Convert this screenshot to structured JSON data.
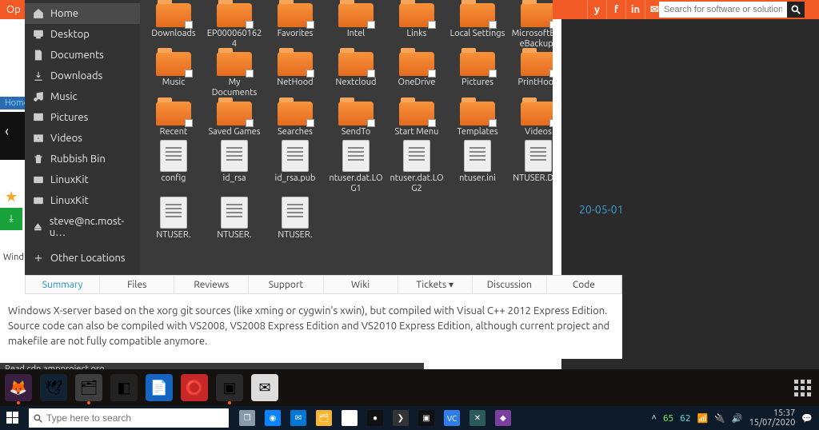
{
  "orange": {
    "op_text": "Op",
    "search_placeholder": "Search for software or solutions"
  },
  "social": [
    "y",
    "f",
    "in",
    "✉"
  ],
  "right_panel": {
    "release_date": "20-05-01"
  },
  "left_frag": {
    "home": "Home",
    "wind": "Wind"
  },
  "fm_sidebar": [
    {
      "icon": "home",
      "label": "Home",
      "sel": true
    },
    {
      "icon": "desktop",
      "label": "Desktop"
    },
    {
      "icon": "doc",
      "label": "Documents"
    },
    {
      "icon": "download",
      "label": "Downloads"
    },
    {
      "icon": "music",
      "label": "Music"
    },
    {
      "icon": "picture",
      "label": "Pictures"
    },
    {
      "icon": "video",
      "label": "Videos"
    },
    {
      "icon": "trash",
      "label": "Rubbish Bin"
    },
    {
      "icon": "disk",
      "label": "LinuxKit"
    },
    {
      "icon": "disk",
      "label": "LinuxKit"
    },
    {
      "icon": "eject",
      "label": "steve@nc.most-u…"
    },
    {
      "icon": "plus",
      "label": "Other Locations",
      "cls": "plus"
    }
  ],
  "fm_items": [
    {
      "t": "fs",
      "n": "Downloads"
    },
    {
      "t": "fs",
      "n": "EP0000601624"
    },
    {
      "t": "fs",
      "n": "Favorites"
    },
    {
      "t": "fs",
      "n": "Intel"
    },
    {
      "t": "fs",
      "n": "Links"
    },
    {
      "t": "fs",
      "n": "Local Settings"
    },
    {
      "t": "fs",
      "n": "MicrosoftEdgeBackups"
    },
    {
      "t": "fs",
      "n": "Music"
    },
    {
      "t": "fs",
      "n": "My Documents"
    },
    {
      "t": "fs",
      "n": "NetHood"
    },
    {
      "t": "fs",
      "n": "Nextcloud"
    },
    {
      "t": "fs",
      "n": "OneDrive"
    },
    {
      "t": "fs",
      "n": "Pictures"
    },
    {
      "t": "fs",
      "n": "PrintHood"
    },
    {
      "t": "fs",
      "n": "Recent"
    },
    {
      "t": "fs",
      "n": "Saved Games"
    },
    {
      "t": "fs",
      "n": "Searches"
    },
    {
      "t": "fs",
      "n": "SendTo"
    },
    {
      "t": "fs",
      "n": "Start Menu"
    },
    {
      "t": "fs",
      "n": "Templates"
    },
    {
      "t": "fs",
      "n": "Videos"
    },
    {
      "t": "d",
      "n": "config"
    },
    {
      "t": "d",
      "n": "id_rsa"
    },
    {
      "t": "d",
      "n": "id_rsa.pub"
    },
    {
      "t": "d",
      "n": "ntuser.dat.LOG1"
    },
    {
      "t": "d",
      "n": "ntuser.dat.LOG2"
    },
    {
      "t": "d",
      "n": "ntuser.ini"
    },
    {
      "t": "d",
      "n": "NTUSER.DAT"
    },
    {
      "t": "d",
      "n": "NTUSER."
    },
    {
      "t": "d",
      "n": "NTUSER."
    },
    {
      "t": "d",
      "n": "NTUSER."
    }
  ],
  "tabs": [
    {
      "label": "Summary",
      "active": true
    },
    {
      "label": "Files"
    },
    {
      "label": "Reviews"
    },
    {
      "label": "Support"
    },
    {
      "label": "Wiki"
    },
    {
      "label": "Tickets ▾"
    },
    {
      "label": "Discussion"
    },
    {
      "label": "Code"
    }
  ],
  "description": "Windows X-server based on the xorg git sources (like xming or cygwin's xwin), but compiled with Visual C++ 2012 Express Edition. Source code can also be compiled with VS2008, VS2008 Express Edition and VS2010 Express Edition, although current project and makefile are not fully compatible anymore.",
  "status_strip": "Read cdn.ampproject.org",
  "dock": [
    {
      "name": "firefox",
      "bg": "#3a2040",
      "glyph": "🦊",
      "pip": true
    },
    {
      "name": "thunderbird",
      "bg": "#123",
      "glyph": "🕊",
      "pip": false
    },
    {
      "name": "files",
      "bg": "#3e3e3e",
      "glyph": "🗂",
      "pip": true
    },
    {
      "name": "rect",
      "bg": "#222",
      "glyph": "◧",
      "pip": false
    },
    {
      "name": "writer",
      "bg": "#1565c0",
      "glyph": "📄",
      "pip": false
    },
    {
      "name": "help",
      "bg": "#c62828",
      "glyph": "⭕",
      "pip": false
    },
    {
      "name": "terminal",
      "bg": "#2a2a2a",
      "glyph": "▣",
      "pip": true
    },
    {
      "name": "mail",
      "bg": "#ddd",
      "glyph": "✉",
      "pip": false
    }
  ],
  "taskbar_search_placeholder": "Type here to search",
  "taskbar_apps": [
    {
      "name": "taskview",
      "c": "#8899aa",
      "g": "❐"
    },
    {
      "name": "edge",
      "c": "#0a84ff",
      "g": "◉"
    },
    {
      "name": "mail",
      "c": "#0078d4",
      "g": "✉"
    },
    {
      "name": "explorer",
      "c": "#f7b531",
      "g": "🗂"
    },
    {
      "name": "store",
      "c": "#ffffff",
      "g": "🛍"
    },
    {
      "name": "blackapp",
      "c": "#111",
      "g": "●"
    },
    {
      "name": "terminal",
      "c": "#333",
      "g": "❯"
    },
    {
      "name": "cmd",
      "c": "#111",
      "g": "▣"
    },
    {
      "name": "vc",
      "c": "#2e7de9",
      "g": "VC"
    },
    {
      "name": "xming",
      "c": "#2a5a5a",
      "g": "✕"
    },
    {
      "name": "affinity",
      "c": "#7b3fa0",
      "g": "◆"
    }
  ],
  "tray": {
    "n1": "65",
    "n2": "62",
    "time": "15:37",
    "date": "15/07/2020"
  }
}
